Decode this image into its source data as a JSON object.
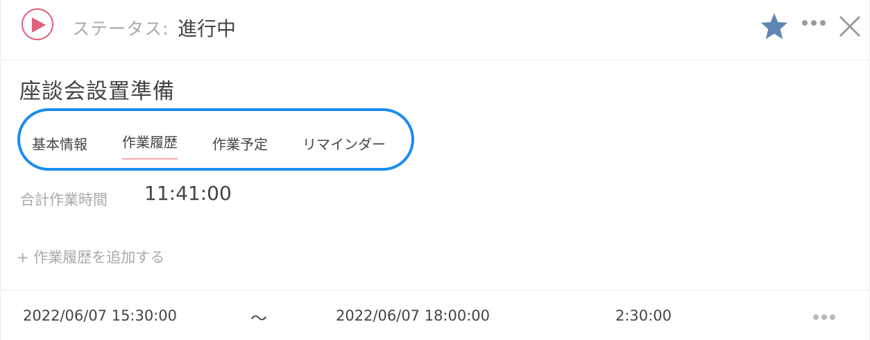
{
  "header": {
    "status_label": "ステータス:",
    "status_value": "進行中",
    "icons": [
      "play-icon",
      "star-icon",
      "more-icon",
      "close-icon"
    ],
    "colors": {
      "play": "#e0607a",
      "star": "#5f86b5",
      "accent": "#1a8cf0"
    }
  },
  "task": {
    "title": "座談会設置準備"
  },
  "tabs": [
    {
      "label": "基本情報",
      "active": false
    },
    {
      "label": "作業履歴",
      "active": true
    },
    {
      "label": "作業予定",
      "active": false
    },
    {
      "label": "リマインダー",
      "active": false
    }
  ],
  "summary": {
    "total_label": "合計作業時間",
    "total_value": "11:41:00"
  },
  "add_history": {
    "label": "+ 作業履歴を追加する"
  },
  "history": [
    {
      "start": "2022/06/07 15:30:00",
      "separator": "〜",
      "end": "2022/06/07 18:00:00",
      "duration": "2:30:00"
    }
  ]
}
